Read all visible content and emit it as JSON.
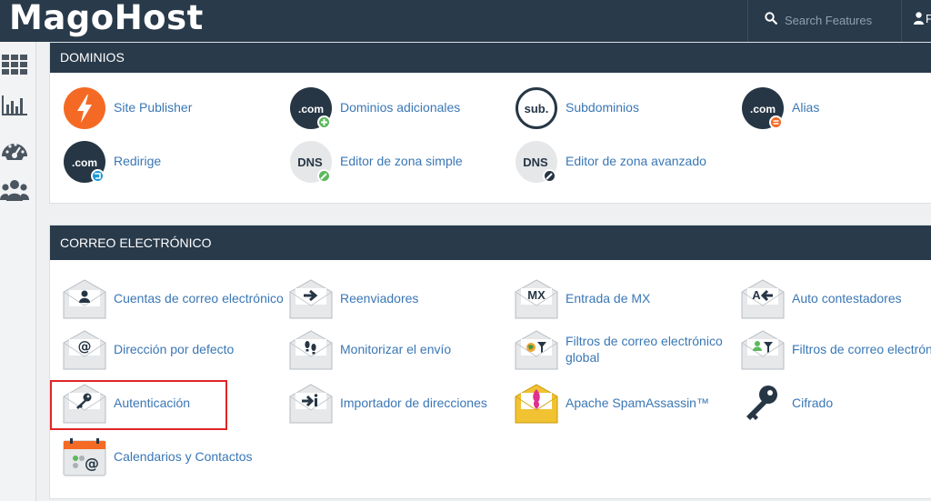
{
  "header": {
    "brand": "MagoHost",
    "search_placeholder": "Search Features",
    "user_initial": "F"
  },
  "sidebar": {
    "items": [
      {
        "name": "grid-icon"
      },
      {
        "name": "bar-chart-icon"
      },
      {
        "name": "dashboard-gauge-icon"
      },
      {
        "name": "users-icon"
      }
    ]
  },
  "sections": {
    "dominios": {
      "title": "DOMINIOS",
      "items": [
        {
          "label": "Site Publisher",
          "icon": "site-publisher-icon"
        },
        {
          "label": "Dominios adicionales",
          "icon": "addon-domains-icon"
        },
        {
          "label": "Subdominios",
          "icon": "subdomains-icon"
        },
        {
          "label": "Alias",
          "icon": "alias-icon"
        },
        {
          "label": "Redirige",
          "icon": "redirects-icon"
        },
        {
          "label": "Editor de zona simple",
          "icon": "simple-zone-editor-icon"
        },
        {
          "label": "Editor de zona avanzado",
          "icon": "advanced-zone-editor-icon"
        }
      ]
    },
    "correo": {
      "title": "CORREO ELECTRÓNICO",
      "items": [
        {
          "label": "Cuentas de correo electrónico",
          "icon": "email-accounts-icon"
        },
        {
          "label": "Reenviadores",
          "icon": "forwarders-icon"
        },
        {
          "label": "Entrada de MX",
          "icon": "mx-entry-icon"
        },
        {
          "label": "Auto contestadores",
          "icon": "autoresponders-icon"
        },
        {
          "label": "Dirección por defecto",
          "icon": "default-address-icon"
        },
        {
          "label": "Monitorizar el envío",
          "icon": "track-delivery-icon"
        },
        {
          "label": "Filtros de correo electrónico global",
          "icon": "global-email-filters-icon"
        },
        {
          "label": "Filtros de correo electrónico",
          "icon": "email-filters-icon"
        },
        {
          "label": "Autenticación",
          "icon": "authentication-icon"
        },
        {
          "label": "Importador de direcciones",
          "icon": "address-importer-icon"
        },
        {
          "label": "Apache SpamAssassin™",
          "icon": "spamassassin-icon"
        },
        {
          "label": "Cifrado",
          "icon": "encryption-key-icon"
        },
        {
          "label": "Calendarios y Contactos",
          "icon": "calendars-contacts-icon"
        }
      ]
    }
  },
  "colors": {
    "header_bg": "#293a4a",
    "link": "#3a77b5",
    "highlight_border": "#e02525",
    "orange": "#f46a24",
    "green": "#5cb85c",
    "blue_badge": "#1b9ad6"
  }
}
